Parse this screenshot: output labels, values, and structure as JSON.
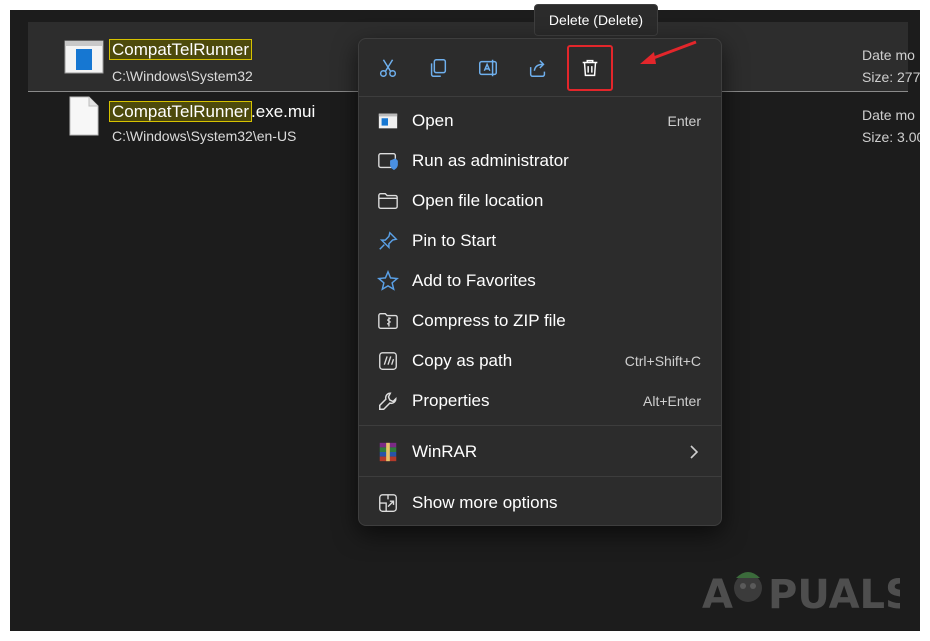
{
  "tooltip": "Delete (Delete)",
  "files": [
    {
      "name_match": "CompatTelRunner",
      "name_suffix": "",
      "path": "C:\\Windows\\System32",
      "meta_line1": "Date mo",
      "meta_line2": "Size: 277",
      "icon": "application-window-icon"
    },
    {
      "name_match": "CompatTelRunner",
      "name_suffix": ".exe.mui",
      "path": "C:\\Windows\\System32\\en-US",
      "meta_line1": "Date mo",
      "meta_line2": "Size: 3.00",
      "icon": "blank-document-icon"
    }
  ],
  "quick_actions": [
    {
      "name": "cut",
      "icon": "scissors-icon"
    },
    {
      "name": "copy",
      "icon": "copy-icon"
    },
    {
      "name": "rename",
      "icon": "rename-icon"
    },
    {
      "name": "share",
      "icon": "share-icon"
    },
    {
      "name": "delete",
      "icon": "trash-icon"
    }
  ],
  "menu": {
    "items": [
      {
        "label": "Open",
        "shortcut": "Enter",
        "icon": "open-window-icon"
      },
      {
        "label": "Run as administrator",
        "shortcut": "",
        "icon": "shield-window-icon"
      },
      {
        "label": "Open file location",
        "shortcut": "",
        "icon": "folder-icon"
      },
      {
        "label": "Pin to Start",
        "shortcut": "",
        "icon": "pin-icon"
      },
      {
        "label": "Add to Favorites",
        "shortcut": "",
        "icon": "star-icon"
      },
      {
        "label": "Compress to ZIP file",
        "shortcut": "",
        "icon": "zip-folder-icon"
      },
      {
        "label": "Copy as path",
        "shortcut": "Ctrl+Shift+C",
        "icon": "copy-path-icon"
      },
      {
        "label": "Properties",
        "shortcut": "Alt+Enter",
        "icon": "wrench-icon"
      }
    ],
    "winrar": {
      "label": "WinRAR",
      "icon": "winrar-icon"
    },
    "more": {
      "label": "Show more options",
      "icon": "more-options-icon"
    }
  },
  "watermark": {
    "text": "A PUALS"
  },
  "colors": {
    "background": "#1c1c1c",
    "menu": "#2c2c2c",
    "highlight_border": "#d6c200",
    "highlight_fill": "#4d4a0c",
    "annotation_red": "#e3262b",
    "icon_blue": "#5aa0e6"
  }
}
